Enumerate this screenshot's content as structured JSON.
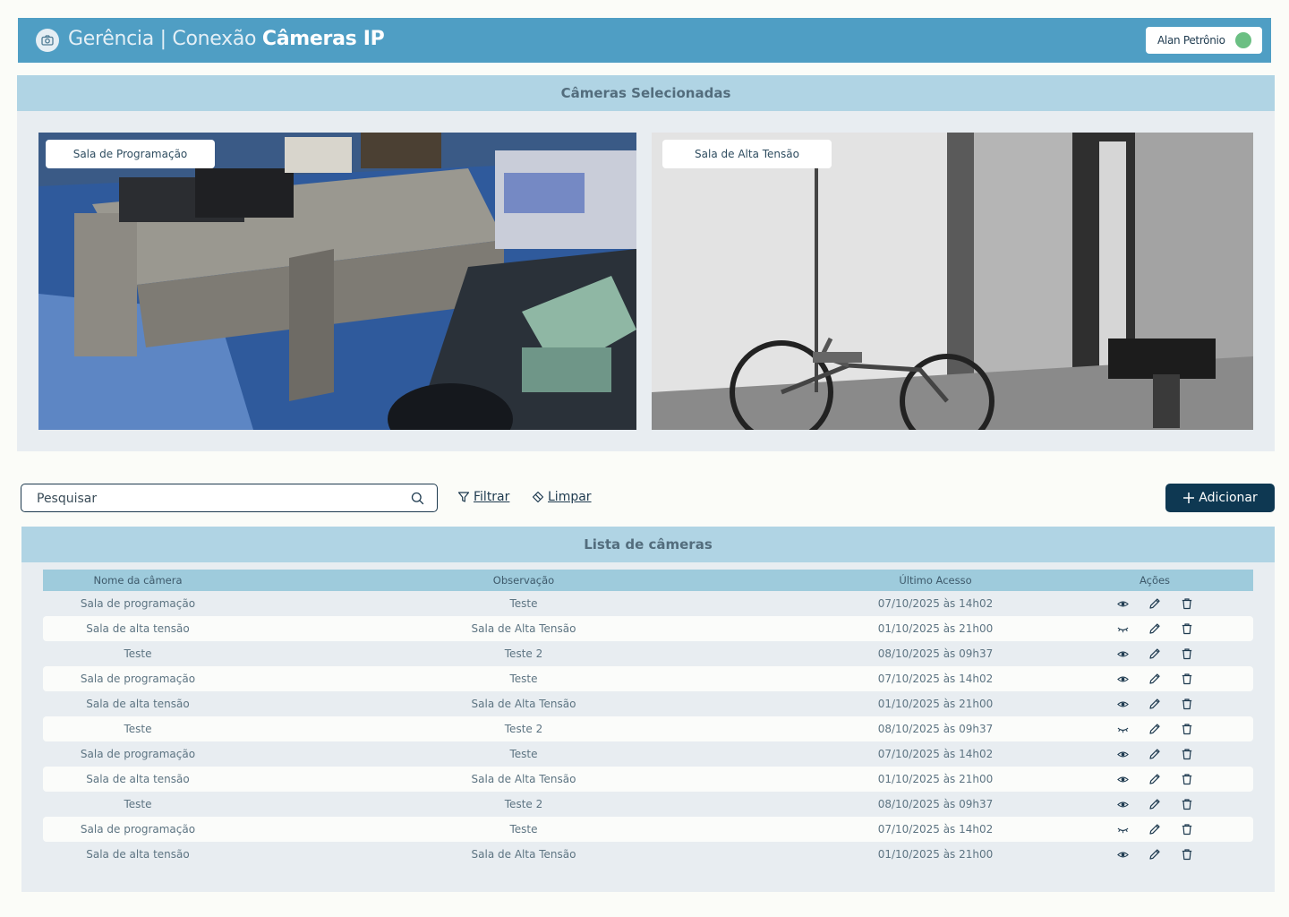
{
  "header": {
    "title_light": "Gerência | Conexão",
    "title_bold": "Câmeras IP",
    "user_name": "Alan Petrônio",
    "status_color": "#6bbf83"
  },
  "selected_cameras": {
    "title": "Câmeras Selecionadas",
    "cameras": [
      {
        "label": "Sala de Programação"
      },
      {
        "label": "Sala de Alta Tensão"
      }
    ]
  },
  "toolbar": {
    "search_placeholder": "Pesquisar",
    "filter_label": "Filtrar",
    "clear_label": "Limpar",
    "add_label": "Adicionar"
  },
  "camera_list": {
    "title": "Lista de câmeras",
    "columns": [
      "Nome da câmera",
      "Observação",
      "Último Acesso",
      "Ações"
    ],
    "rows": [
      {
        "name": "Sala de programação",
        "note": "Teste",
        "last_access": "07/10/2025 às 14h02",
        "visible": true
      },
      {
        "name": "Sala de alta tensão",
        "note": "Sala de Alta Tensão",
        "last_access": "01/10/2025 às 21h00",
        "visible": false
      },
      {
        "name": "Teste",
        "note": "Teste 2",
        "last_access": "08/10/2025 às 09h37",
        "visible": true
      },
      {
        "name": "Sala de programação",
        "note": "Teste",
        "last_access": "07/10/2025 às 14h02",
        "visible": true
      },
      {
        "name": "Sala de alta tensão",
        "note": "Sala de Alta Tensão",
        "last_access": "01/10/2025 às 21h00",
        "visible": true
      },
      {
        "name": "Teste",
        "note": "Teste 2",
        "last_access": "08/10/2025 às 09h37",
        "visible": false
      },
      {
        "name": "Sala de programação",
        "note": "Teste",
        "last_access": "07/10/2025 às 14h02",
        "visible": true
      },
      {
        "name": "Sala de alta tensão",
        "note": "Sala de Alta Tensão",
        "last_access": "01/10/2025 às 21h00",
        "visible": true
      },
      {
        "name": "Teste",
        "note": "Teste 2",
        "last_access": "08/10/2025 às 09h37",
        "visible": true
      },
      {
        "name": "Sala de programação",
        "note": "Teste",
        "last_access": "07/10/2025 às 14h02",
        "visible": false
      },
      {
        "name": "Sala de alta tensão",
        "note": "Sala de Alta Tensão",
        "last_access": "01/10/2025 às 21h00",
        "visible": true
      }
    ]
  },
  "colors": {
    "topbar": "#4f9ec4",
    "panel_header": "#b0d4e4",
    "table_header": "#9ecbdc",
    "primary_button": "#0e3852"
  }
}
